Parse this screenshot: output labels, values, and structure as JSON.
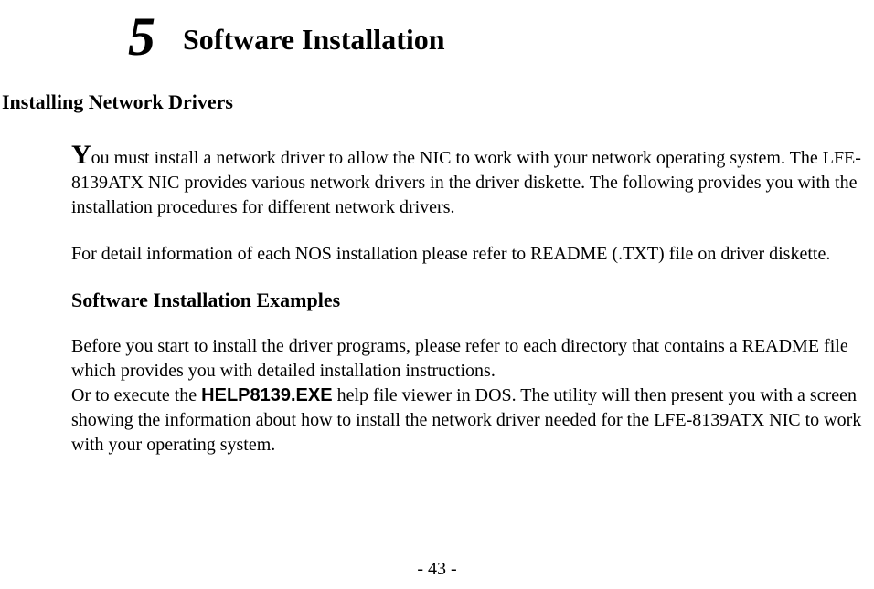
{
  "chapter": {
    "number": "5",
    "title": "Software Installation"
  },
  "section_heading": "Installing Network Drivers",
  "paragraph1": {
    "dropcap": "Y",
    "rest": "ou must install a network driver to allow the NIC to work with your network operating system. The LFE-8139ATX NIC provides various network drivers in the driver diskette. The following provides you with the installation procedures for different network drivers."
  },
  "paragraph2": "For detail information of each NOS installation please refer to README (.TXT) file on driver diskette.",
  "subheading": "Software Installation Examples",
  "paragraph3": "Before you start to install the driver programs, please refer to each directory that contains a README file which provides you with detailed installation instructions.",
  "paragraph4": {
    "pre": "Or to execute the ",
    "bold": "HELP8139.EXE",
    "post": " help file viewer in DOS. The utility will then present you with a screen showing the information about how to install the network driver needed for the LFE-8139ATX NIC to work with your operating system."
  },
  "page_number": "- 43 -"
}
